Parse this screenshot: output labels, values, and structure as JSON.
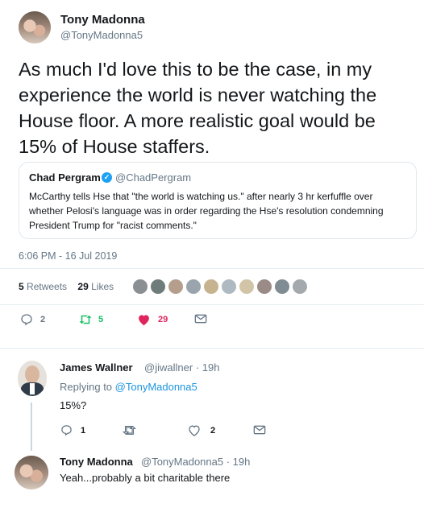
{
  "main_tweet": {
    "author_name": "Tony Madonna",
    "author_handle": "@TonyMadonna5",
    "text": "As much I'd love this to be the case, in my experience the world is never watching the House floor. A more realistic goal would be 15% of House staffers.",
    "quote": {
      "author_name": "Chad Pergram",
      "verified_mark": "✓",
      "author_handle": "@ChadPergram",
      "text": "McCarthy tells Hse that \"the world is watching us.\" after nearly 3 hr kerfuffle over whether Pelosi's language was in order regarding the Hse's resolution condemning President Trump for \"racist comments.\""
    },
    "timestamp": "6:06 PM - 16 Jul 2019",
    "retweets_count": "5",
    "retweets_label": "Retweets",
    "likes_count": "29",
    "likes_label": "Likes",
    "actions": {
      "reply_count": "2",
      "retweet_count": "5",
      "like_count": "29"
    }
  },
  "replies": [
    {
      "author_name": "James Wallner",
      "author_handle": "@jiwallner",
      "age": "· 19h",
      "replying_prefix": "Replying to ",
      "replying_to": "@TonyMadonna5",
      "text": "15%?",
      "reply_count": "1",
      "like_count": "2"
    },
    {
      "author_name": "Tony Madonna",
      "author_handle": "@TonyMadonna5",
      "age": "· 19h",
      "text": "Yeah...probably a bit charitable there"
    }
  ],
  "colors": {
    "brand_blue": "#1da1f2",
    "retweet_green": "#17bf63",
    "like_red": "#e0245e",
    "secondary_text": "#657786"
  }
}
